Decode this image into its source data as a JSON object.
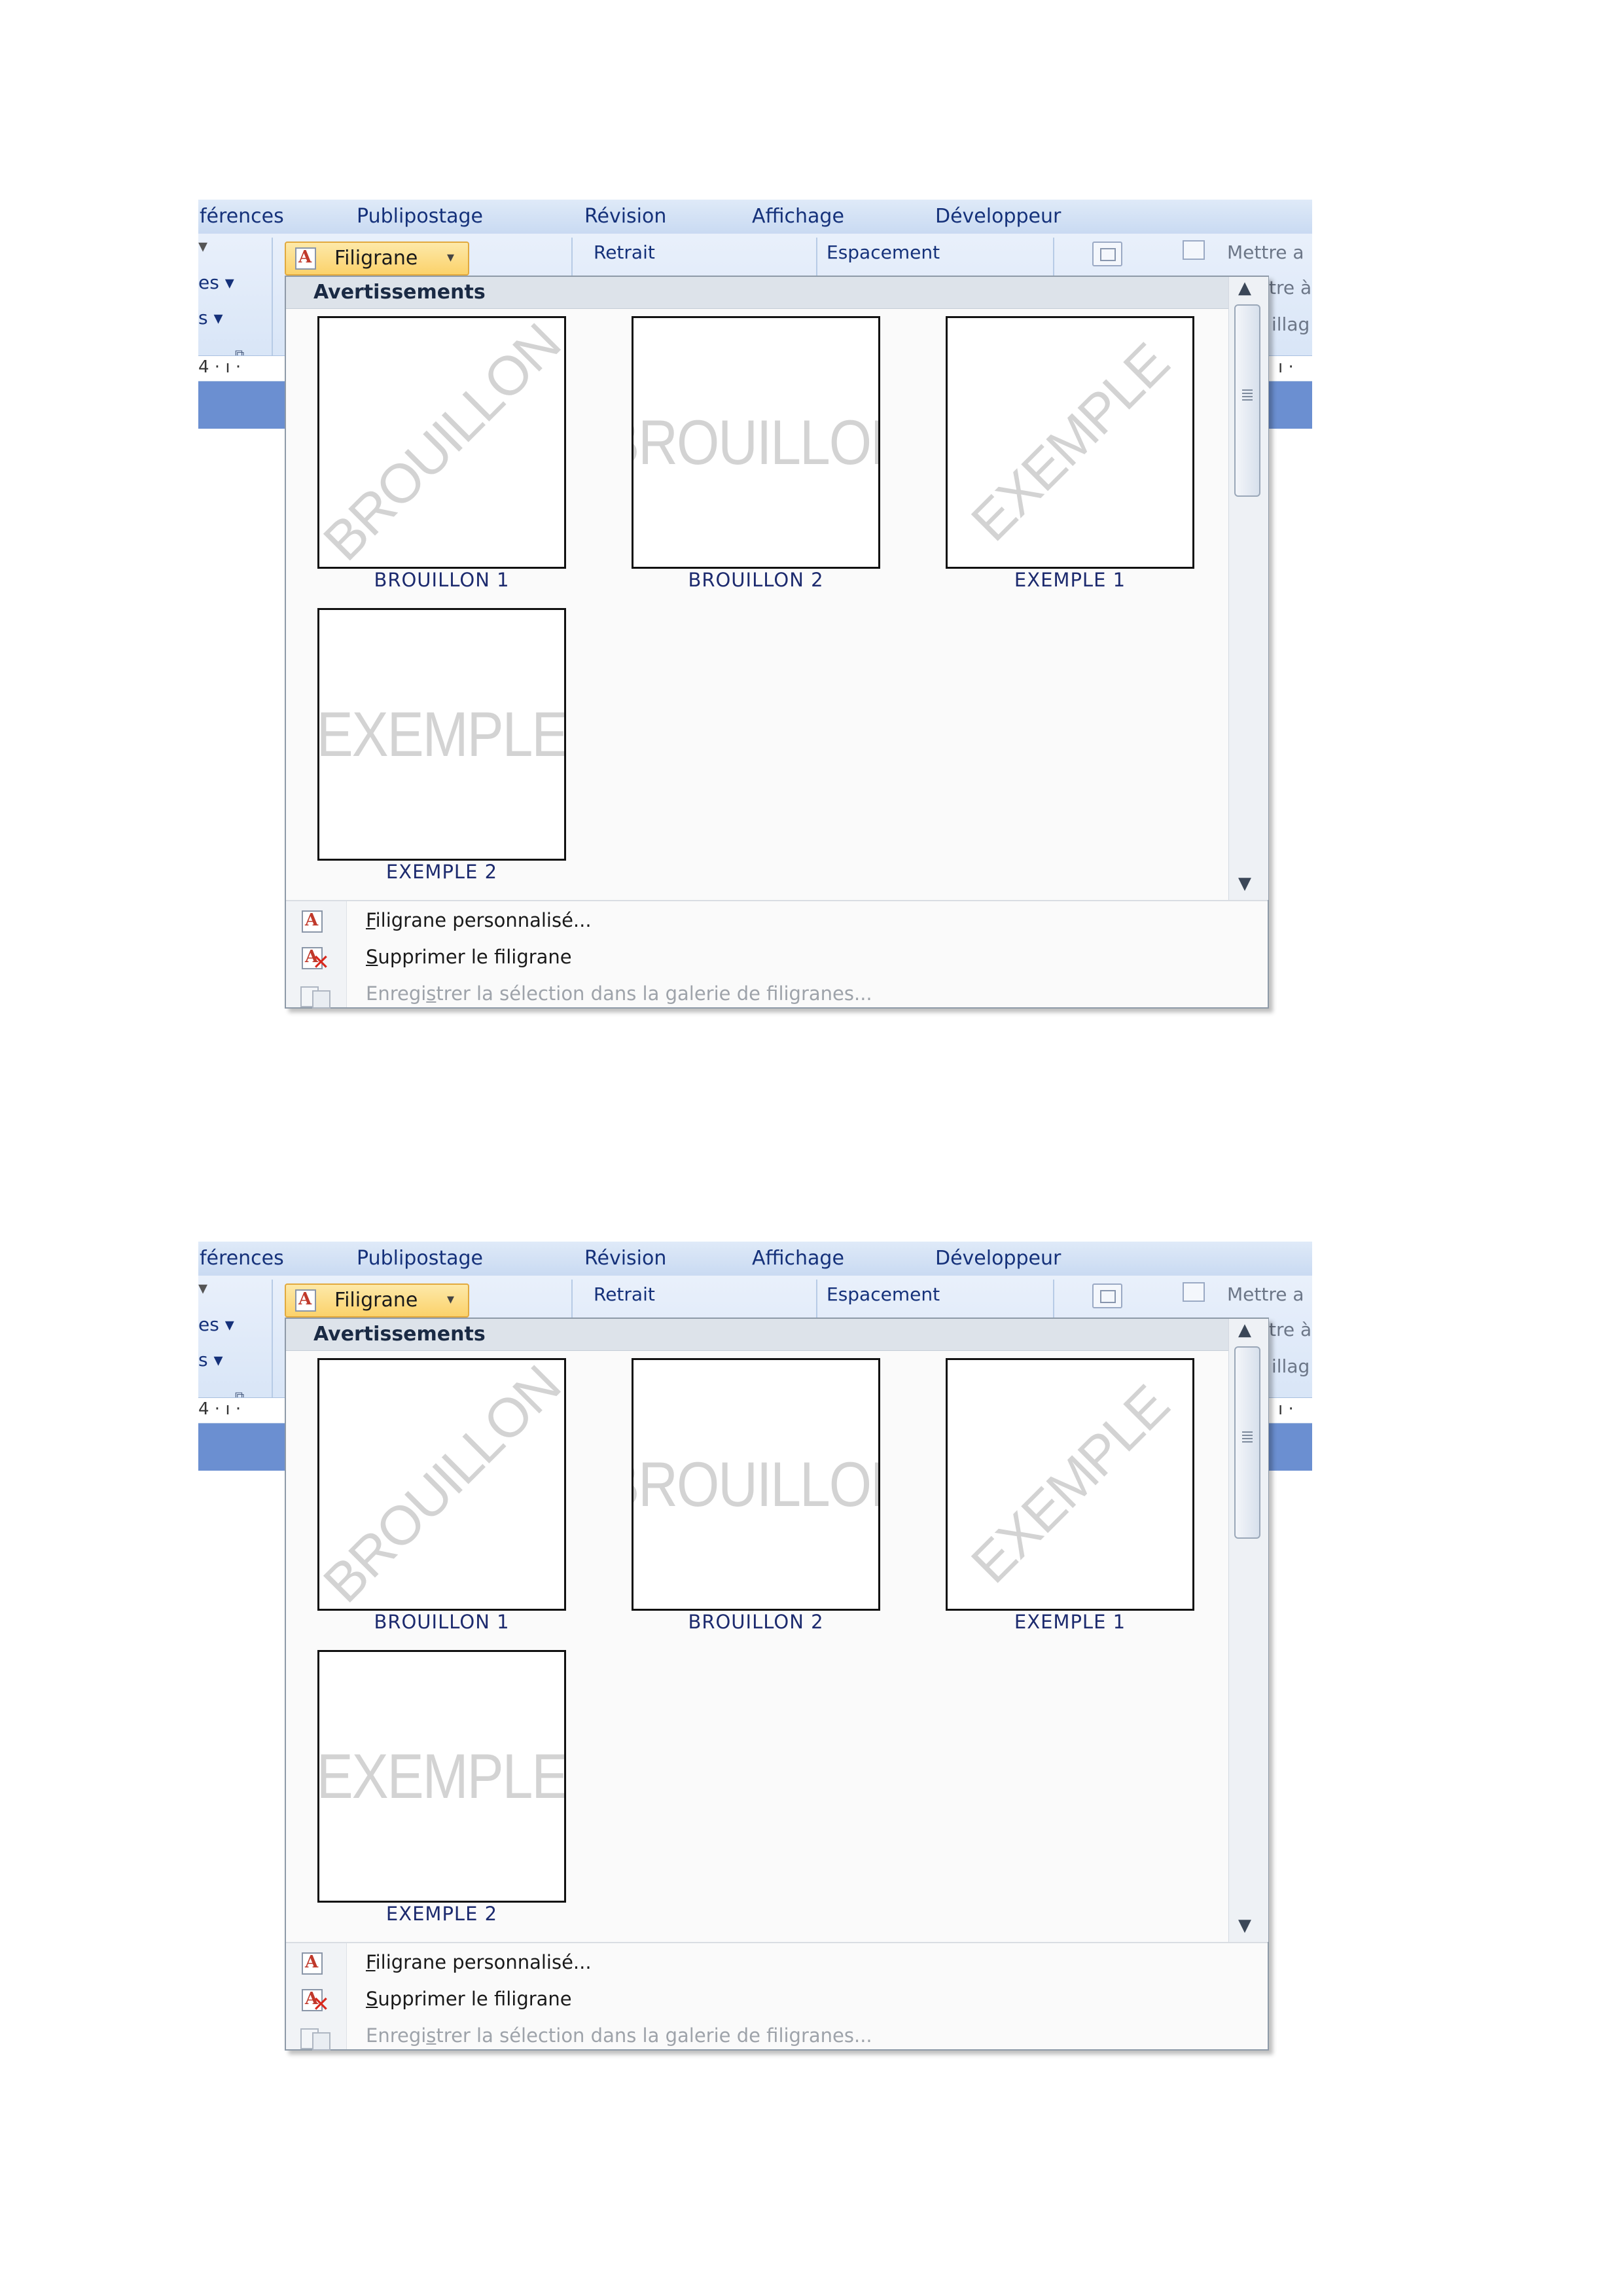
{
  "ribbon": {
    "tabs": [
      "férences",
      "Publipostage",
      "Révision",
      "Affichage",
      "Développeur"
    ],
    "left_group_items": [
      "es",
      "s"
    ],
    "fil_button_label": "Filigrane",
    "retrait_label": "Retrait",
    "espacement_label": "Espacement",
    "right_labels": [
      "Mettre a",
      "tre à",
      "illag"
    ],
    "ruler_left": "4 · ı ·",
    "ruler_right": "ı ·"
  },
  "dropdown": {
    "category_header": "Avertissements",
    "gallery": [
      {
        "caption": "BROUILLON 1",
        "watermark": "BROUILLON",
        "orientation": "diagonal"
      },
      {
        "caption": "BROUILLON 2",
        "watermark": "BROUILLON",
        "orientation": "horizontal"
      },
      {
        "caption": "EXEMPLE 1",
        "watermark": "EXEMPLE",
        "orientation": "diagonal"
      },
      {
        "caption": "EXEMPLE 2",
        "watermark": "EXEMPLE",
        "orientation": "horizontal"
      }
    ],
    "menu": [
      {
        "accel": "F",
        "rest": "iligrane personnalisé...",
        "icon": "watermark-icon",
        "enabled": true
      },
      {
        "accel": "S",
        "rest": "upprimer le filigrane",
        "icon": "remove-watermark-icon",
        "enabled": true
      },
      {
        "before": "Enregi",
        "accel": "s",
        "rest": "trer la sélection dans la galerie de filigranes...",
        "icon": "save-to-gallery-icon",
        "enabled": false
      }
    ]
  },
  "colors": {
    "tab_text": "#15317a",
    "button_highlight": "#fbd26b",
    "caption_text": "#1c2a6e",
    "watermark_gray": "#d3d3d3",
    "remove_icon_red": "#d8271c"
  }
}
